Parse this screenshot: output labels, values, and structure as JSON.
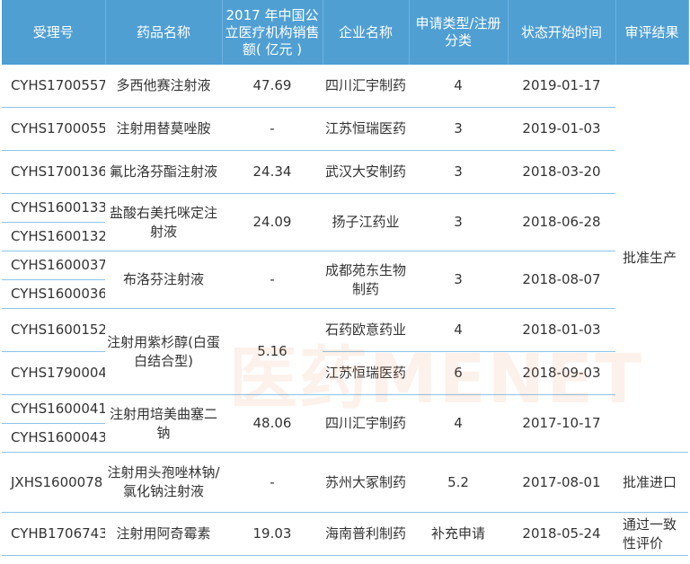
{
  "headers": [
    "受理号",
    "药品名称",
    "2017 年中国公立医疗机构销售额( 亿元 )",
    "企业名称",
    "申请类型/注册分类",
    "状态开始时间",
    "审评结果"
  ],
  "rows": [
    {
      "id": "CYHS1700557",
      "drug": "多西他赛注射液",
      "sales": "47.69",
      "company": "四川汇宇制药",
      "type": "4",
      "date": "2019-01-17"
    },
    {
      "id": "CYHS1700055",
      "drug": "注射用替莫唑胺",
      "sales": "-",
      "company": "江苏恒瑞医药",
      "type": "3",
      "date": "2019-01-03"
    },
    {
      "id": "CYHS1700136",
      "drug": "氟比洛芬酯注射液",
      "sales": "24.34",
      "company": "武汉大安制药",
      "type": "3",
      "date": "2018-03-20"
    },
    {
      "id": "CYHS1600133",
      "drug": "盐酸右美托咪定注射液",
      "sales": "24.09",
      "company": "扬子江药业",
      "type": "3",
      "date": "2018-06-28"
    },
    {
      "id": "CYHS1600132"
    },
    {
      "id": "CYHS1600037",
      "drug": "布洛芬注射液",
      "sales": "-",
      "company": "成都苑东生物制药",
      "type": "3",
      "date": "2018-08-07"
    },
    {
      "id": "CYHS1600036"
    },
    {
      "id": "CYHS1600152",
      "drug": "注射用紫杉醇(白蛋白结合型)",
      "sales": "5.16",
      "company": "石药欧意药业",
      "type": "4",
      "date": "2018-01-03"
    },
    {
      "id": "CYHS1790004",
      "company": "江苏恒瑞医药",
      "type": "6",
      "date": "2018-09-03"
    },
    {
      "id": "CYHS1600041",
      "drug": "注射用培美曲塞二钠",
      "sales": "48.06",
      "company": "四川汇宇制药",
      "type": "4",
      "date": "2017-10-17"
    },
    {
      "id": "CYHS1600043"
    },
    {
      "id": "JXHS1600078",
      "drug": "注射用头孢唑林钠/氯化钠注射液",
      "sales": "-",
      "company": "苏州大冢制药",
      "type": "5.2",
      "date": "2017-08-01",
      "result": "批准进口"
    },
    {
      "id": "CYHB1706743",
      "drug": "注射用阿奇霉素",
      "sales": "19.03",
      "company": "海南普利制药",
      "type": "补充申请",
      "date": "2018-05-24",
      "result": "通过一致性评价"
    }
  ],
  "result_production": "批准生产",
  "watermark": "医药MENET"
}
